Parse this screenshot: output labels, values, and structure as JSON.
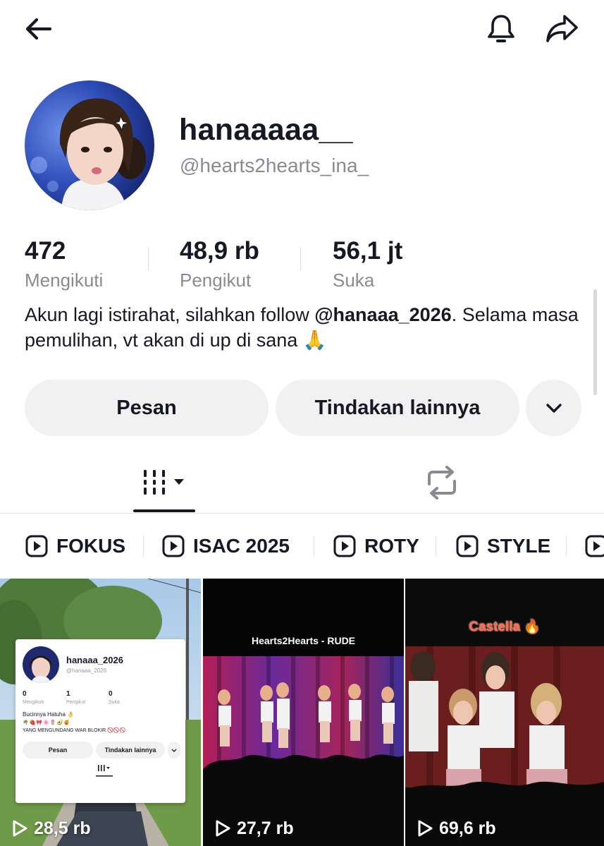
{
  "topbar": {
    "back_icon": "arrow-left-icon",
    "notification_icon": "bell-icon",
    "share_icon": "share-arrow-icon"
  },
  "profile": {
    "display_name": "hanaaaaa__",
    "handle": "@hearts2hearts_ina_",
    "stats": [
      {
        "value": "472",
        "label": "Mengikuti"
      },
      {
        "value": "48,9 rb",
        "label": "Pengikut"
      },
      {
        "value": "56,1 jt",
        "label": "Suka"
      }
    ],
    "bio_pre": "Akun lagi istirahat, silahkan follow ",
    "bio_mention": "@hanaaa_2026",
    "bio_post": ". Selama masa pemulihan, vt akan di up di sana 🙏"
  },
  "actions": {
    "message_label": "Pesan",
    "more_actions_label": "Tindakan lainnya",
    "dropdown_icon": "chevron-down-icon"
  },
  "tabs": {
    "videos_icon": "grid-bars-icon",
    "reposts_icon": "repost-icon"
  },
  "playlists": [
    {
      "label": "FOKUS"
    },
    {
      "label": "ISAC 2025"
    },
    {
      "label": "ROTY"
    },
    {
      "label": "STYLE"
    }
  ],
  "videos": [
    {
      "views": "28,5 rb",
      "mini": {
        "name": "hanaaa_2026",
        "handle": "@hanaaa_2026",
        "stats": [
          {
            "value": "0",
            "label": "Mengikuti"
          },
          {
            "value": "1",
            "label": "Pengikut"
          },
          {
            "value": "0",
            "label": "Suka"
          }
        ],
        "bio1": "Bucinnya Hatuha 👌",
        "bio2": "🌴🍓🎀🌸🌷🥑🍯",
        "bio3": "YANG MENGUNDANG WAR BLOKIR 🚫🚫🚫",
        "btn1": "Pesan",
        "btn2": "Tindakan lainnya"
      }
    },
    {
      "views": "27,7 rb",
      "title": "Hearts2Hearts - RUDE"
    },
    {
      "views": "69,6 rb",
      "title": "Castella 🔥"
    }
  ],
  "colors": {
    "text": "#161823",
    "secondary": "#8a8b91",
    "button_bg": "#f1f1f2",
    "divider": "#e3e3e4"
  }
}
